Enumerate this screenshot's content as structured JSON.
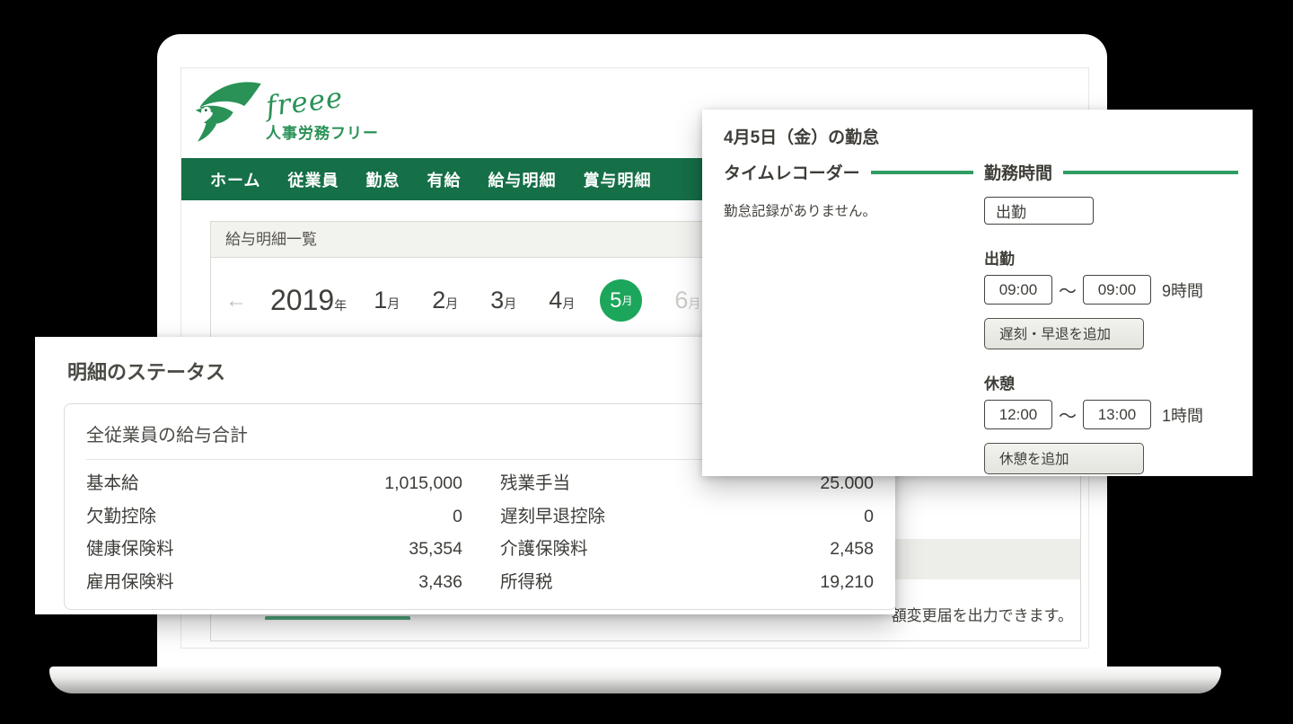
{
  "app": {
    "logo_text": "freee",
    "logo_subtext": "人事労務フリー"
  },
  "nav": {
    "items": [
      "ホーム",
      "従業員",
      "勤怠",
      "有給",
      "給与明細",
      "賞与明細"
    ]
  },
  "payroll": {
    "list_title": "給与明細一覧",
    "prev_arrow": "←",
    "year": "2019",
    "year_suffix": "年",
    "months": [
      "1",
      "2",
      "3",
      "4",
      "5",
      "6"
    ],
    "month_suffix": "月",
    "footer_note": "額変更届を出力できます。"
  },
  "status_card": {
    "title": "明細のステータス",
    "summary_title": "全従業員の給与合計",
    "rows": [
      {
        "label": "基本給",
        "value": "1,015,000",
        "label2": "残業手当",
        "value2": "25.000"
      },
      {
        "label": "欠勤控除",
        "value": "0",
        "label2": "遅刻早退控除",
        "value2": "0"
      },
      {
        "label": "健康保険料",
        "value": "35,354",
        "label2": "介護保険料",
        "value2": "2,458"
      },
      {
        "label": "雇用保険料",
        "value": "3,436",
        "label2": "所得税",
        "value2": "19,210"
      }
    ]
  },
  "attendance_card": {
    "title": "4月5日（金）の勤怠",
    "time_recorder": {
      "heading": "タイムレコーダー",
      "empty_message": "勤怠記録がありません。"
    },
    "work_time": {
      "heading": "勤務時間",
      "clock_in_button": "出勤",
      "work_label": "出勤",
      "work_start": "09:00",
      "work_end": "09:00",
      "work_duration": "9時間",
      "range_separator": "～",
      "late_early_button": "遅刻・早退を追加",
      "break_label": "休憩",
      "break_start": "12:00",
      "break_end": "13:00",
      "break_duration": "1時間",
      "break_add_button": "休憩を追加"
    }
  },
  "colors": {
    "nav_green": "#156f47",
    "accent_green": "#1ca65b",
    "line_green": "#2f9d61",
    "logo_green": "#2a9257"
  }
}
